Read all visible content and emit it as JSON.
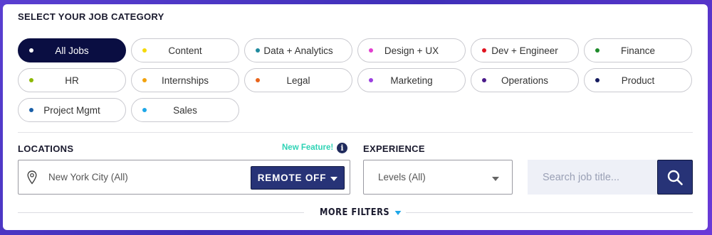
{
  "header": {
    "title": "SELECT YOUR JOB CATEGORY"
  },
  "categories": [
    {
      "label": "All Jobs",
      "dot_color": "#ffffff",
      "active": true
    },
    {
      "label": "Content",
      "dot_color": "#f5d90a",
      "active": false
    },
    {
      "label": "Data + Analytics",
      "dot_color": "#1f8a9e",
      "active": false
    },
    {
      "label": "Design + UX",
      "dot_color": "#e23fcf",
      "active": false
    },
    {
      "label": "Dev + Engineer",
      "dot_color": "#e0131f",
      "active": false
    },
    {
      "label": "Finance",
      "dot_color": "#1e8a2a",
      "active": false
    },
    {
      "label": "HR",
      "dot_color": "#8cb800",
      "active": false
    },
    {
      "label": "Internships",
      "dot_color": "#f2a20d",
      "active": false
    },
    {
      "label": "Legal",
      "dot_color": "#e8641a",
      "active": false
    },
    {
      "label": "Marketing",
      "dot_color": "#9b3fe0",
      "active": false
    },
    {
      "label": "Operations",
      "dot_color": "#4a1a8a",
      "active": false
    },
    {
      "label": "Product",
      "dot_color": "#141a5e",
      "active": false
    },
    {
      "label": "Project Mgmt",
      "dot_color": "#1a5fa8",
      "active": false
    },
    {
      "label": "Sales",
      "dot_color": "#1ea7e8",
      "active": false
    }
  ],
  "locations": {
    "label": "LOCATIONS",
    "new_feature": "New Feature!",
    "info_glyph": "i",
    "value": "New York City (All)",
    "remote_button": "REMOTE OFF"
  },
  "experience": {
    "label": "EXPERIENCE",
    "value": "Levels (All)"
  },
  "search": {
    "placeholder": "Search job title..."
  },
  "more_filters": {
    "label": "MORE FILTERS"
  },
  "colors": {
    "accent_dark": "#0a0e42",
    "button_navy": "#273377",
    "new_feature": "#2ed3b5",
    "caret_blue": "#1ea7e8"
  }
}
